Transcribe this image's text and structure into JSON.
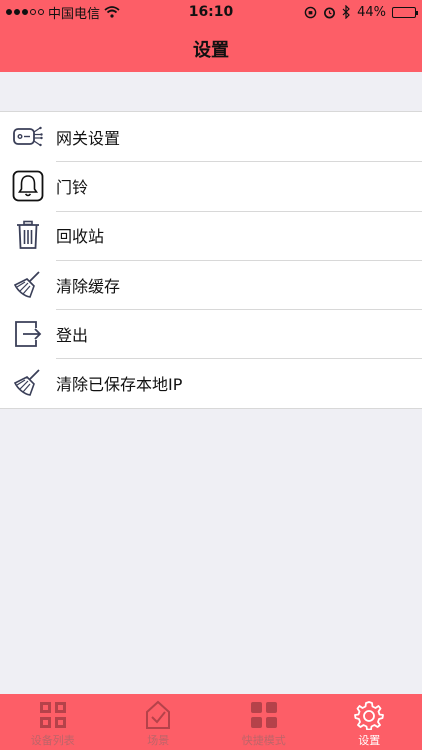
{
  "status": {
    "carrier": "中国电信",
    "time": "16:10",
    "battery": "44%",
    "battery_level": 0.44
  },
  "header": {
    "title": "设置"
  },
  "menu": [
    {
      "label": "网关设置",
      "icon": "gateway-icon"
    },
    {
      "label": "门铃",
      "icon": "bell-icon"
    },
    {
      "label": "回收站",
      "icon": "trash-icon"
    },
    {
      "label": "清除缓存",
      "icon": "broom-icon"
    },
    {
      "label": "登出",
      "icon": "logout-icon"
    },
    {
      "label": "清除已保存本地IP",
      "icon": "broom-icon"
    }
  ],
  "tabs": [
    {
      "label": "设备列表",
      "icon": "grid-icon",
      "active": false
    },
    {
      "label": "场景",
      "icon": "scene-icon",
      "active": false
    },
    {
      "label": "快捷模式",
      "icon": "quick-mode-icon",
      "active": false
    },
    {
      "label": "设置",
      "icon": "gear-icon",
      "active": true
    }
  ],
  "colors": {
    "accent": "#fd5e67",
    "background": "#efeff4"
  }
}
